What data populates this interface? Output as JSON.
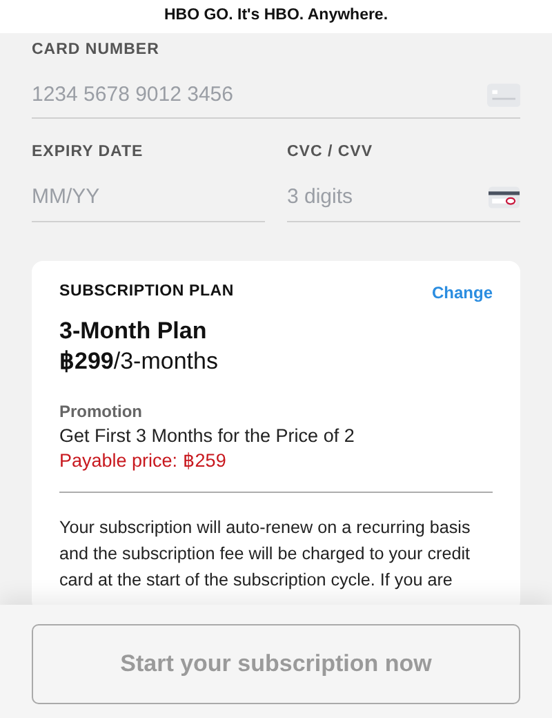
{
  "header": {
    "title": "HBO GO. It's HBO. Anywhere."
  },
  "card_number": {
    "label": "CARD NUMBER",
    "placeholder": "1234 5678 9012 3456"
  },
  "expiry": {
    "label": "EXPIRY DATE",
    "placeholder": "MM/YY"
  },
  "cvc": {
    "label": "CVC / CVV",
    "placeholder": "3 digits"
  },
  "plan": {
    "heading": "SUBSCRIPTION PLAN",
    "change_link": "Change",
    "name": "3-Month Plan",
    "price": "**฿299**/3-months",
    "promotion_label": "Promotion",
    "promotion": "Get First 3 Months for the Price of 2",
    "payable_price": "Payable price: ฿259",
    "notice": "Your subscription will auto-renew on a recurring basis and the subscription fee will be charged to your credit card at the start of the subscription cycle. If you are"
  },
  "submit": {
    "label": "Start your subscription now",
    "disabled": true
  }
}
